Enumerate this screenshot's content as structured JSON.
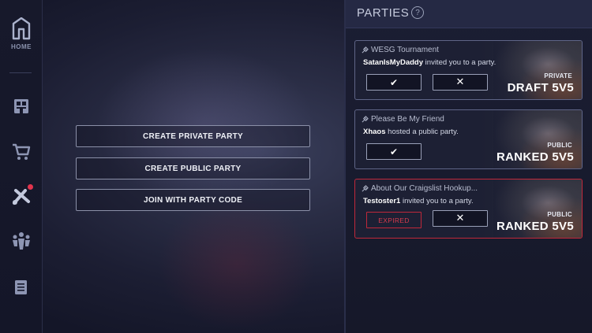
{
  "sidebar": {
    "home_label": "HOME",
    "items": [
      {
        "icon": "home-icon"
      },
      {
        "icon": "collection-icon"
      },
      {
        "icon": "cart-icon"
      },
      {
        "icon": "play-icon",
        "notification": true
      },
      {
        "icon": "social-icon"
      },
      {
        "icon": "scroll-icon"
      }
    ]
  },
  "menu": {
    "create_private": "CREATE PRIVATE PARTY",
    "create_public": "CREATE PUBLIC PARTY",
    "join_code": "JOIN WITH PARTY  CODE"
  },
  "parties": {
    "title": "PARTIES",
    "help": "?",
    "cards": [
      {
        "title": "WESG Tournament",
        "user": "SatanIsMyDaddy",
        "message": " invited you to a party.",
        "visibility": "PRIVATE",
        "mode": "DRAFT 5V5",
        "accept": "✔",
        "decline": "✕"
      },
      {
        "title": "Please Be My Friend",
        "user": "Xhaos",
        "message": " hosted a public party.",
        "visibility": "PUBLIC",
        "mode": "RANKED 5V5",
        "accept": "✔"
      },
      {
        "title": "About Our Craigslist Hookup...",
        "user": "Testoster1",
        "message": " invited you to a party.",
        "status": "EXPIRED",
        "visibility": "PUBLIC",
        "mode": "RANKED 5V5",
        "decline": "✕"
      }
    ]
  },
  "colors": {
    "background": "#1c1e33",
    "panel": "#1b1e33",
    "card_border": "#5f6587",
    "expired": "#c0283a",
    "notification": "#e2344d"
  }
}
